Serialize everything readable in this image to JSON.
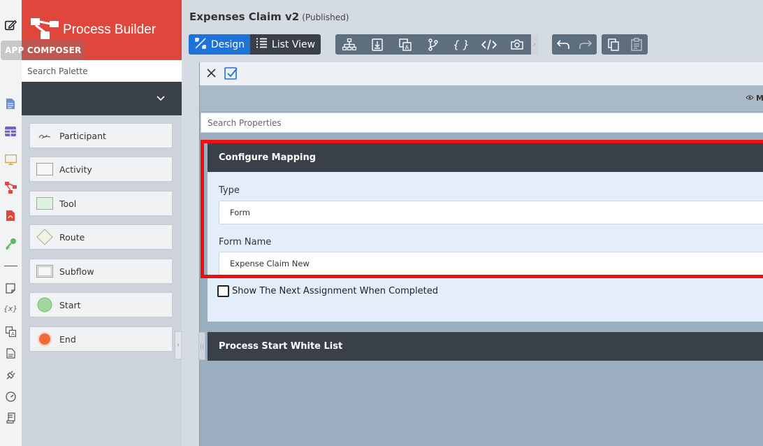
{
  "app": {
    "app_composer_label": "APP COMPOSER",
    "builder_title": "Process Builder",
    "accent_color": "#e0473c"
  },
  "rail": {
    "icons": [
      "edit-icon",
      "document-icon",
      "table-icon",
      "monitor-icon",
      "hierarchy-icon",
      "pdf-icon",
      "key-icon",
      "note-icon",
      "variable-icon",
      "translate-icon",
      "file-icon",
      "plug-icon",
      "gauge-icon",
      "scroll-icon"
    ],
    "variable_glyph": "{x}"
  },
  "palette": {
    "search_placeholder": "Search Palette",
    "items": [
      {
        "label": "Participant"
      },
      {
        "label": "Activity"
      },
      {
        "label": "Tool"
      },
      {
        "label": "Route"
      },
      {
        "label": "Subflow"
      },
      {
        "label": "Start"
      },
      {
        "label": "End"
      }
    ]
  },
  "header": {
    "title": "Expenses Claim v2",
    "status": "(Published)"
  },
  "toolbar": {
    "design_label": "Design",
    "list_view_label": "List View",
    "tools": [
      "tree-icon",
      "import-icon",
      "translate-icon",
      "branch-icon",
      "braces-icon",
      "code-icon",
      "camera-icon"
    ],
    "braces_glyph": "{ }",
    "primary_color": "#1e73d8"
  },
  "properties": {
    "search_placeholder": "Search Properties",
    "m_label": "M",
    "section_title": "Configure Mapping",
    "type_label": "Type",
    "type_value": "Form",
    "form_name_label": "Form Name",
    "form_name_value": "Expense Claim New",
    "checkbox_label": "Show The Next Assignment When Completed",
    "checkbox_checked": false,
    "section2_title": "Process Start White List",
    "highlight_color": "#f00f0f"
  }
}
